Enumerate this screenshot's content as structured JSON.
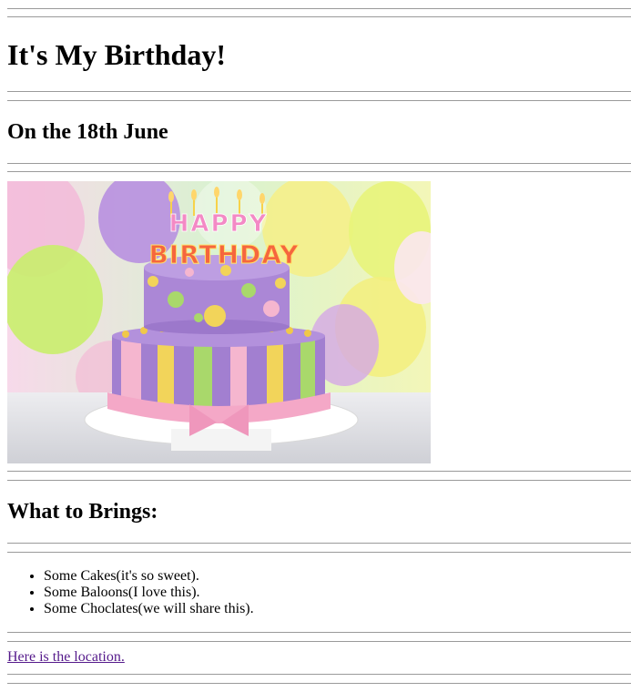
{
  "page": {
    "title": "It's My Birthday!",
    "date_heading": "On the 18th June",
    "image": {
      "icon": "birthday-cake-photo",
      "topper_line1": "HAPPY",
      "topper_line2": "BIRTHDAY"
    },
    "bring_heading": "What to Brings:",
    "bring_items": [
      "Some Cakes(it's so sweet).",
      "Some Baloons(I love this).",
      "Some Choclates(we will share this)."
    ],
    "location_link": "Here is the location."
  },
  "colors": {
    "rule": "#9a9a9a",
    "link_visited": "#551a8b",
    "cake_purple": "#a27fd0",
    "cake_pink": "#f5b6cf",
    "cake_yellow": "#f2d45a",
    "cake_green": "#a9d86b"
  }
}
